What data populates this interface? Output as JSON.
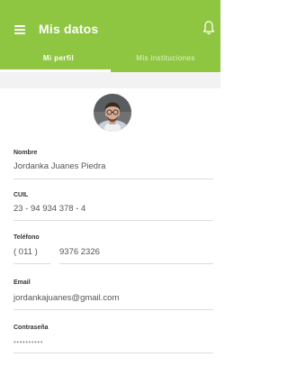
{
  "header": {
    "title": "Mis datos",
    "menu_icon": "hamburger-menu-icon",
    "bell_icon": "bell-icon",
    "color": "#8fc641"
  },
  "tabs": [
    {
      "label": "Mi perfil",
      "active": true
    },
    {
      "label": "Mis instituciones",
      "active": false
    }
  ],
  "profile": {
    "avatar_icon": "user-avatar",
    "fields": {
      "nombre": {
        "label": "Nombre",
        "value": "Jordanka Juanes Piedra"
      },
      "cuil": {
        "label": "CUIL",
        "value": "23 - 94 934 378 - 4"
      },
      "telefono": {
        "label": "Teléfono",
        "area": "( 011 )",
        "number": "9376 2326"
      },
      "email": {
        "label": "Email",
        "value": "jordankajuanes@gmail.com"
      },
      "password": {
        "label": "Contraseña",
        "value": "••••••••••"
      }
    }
  }
}
